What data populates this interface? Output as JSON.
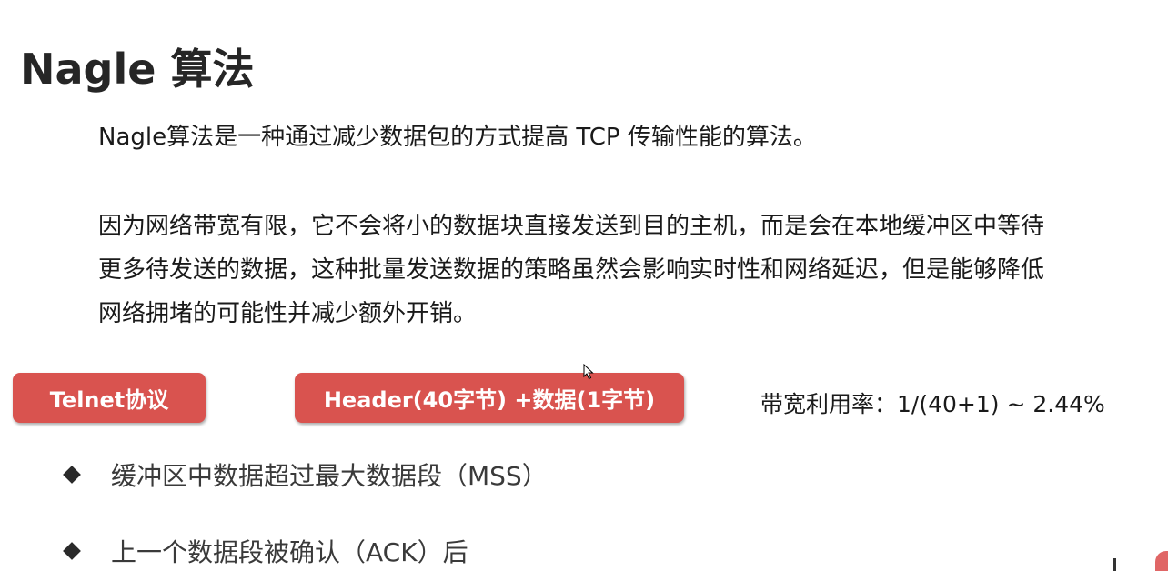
{
  "title": "Nagle 算法",
  "intro": "Nagle算法是一种通过减少数据包的方式提高 TCP 传输性能的算法。",
  "explanation_lines": [
    "因为网络带宽有限，它不会将小的数据块直接发送到目的主机，而是会在本地缓冲区中等待",
    "更多待发送的数据，这种批量发送数据的策略虽然会影响实时性和网络延迟，但是能够降低",
    "网络拥堵的可能性并减少额外开销。"
  ],
  "telnet_label": "Telnet协议",
  "header_label": "Header(40字节) +数据(1字节)",
  "utilization": "带宽利用率：1/(40+1) ~ 2.44%",
  "bullets": [
    "缓冲区中数据超过最大数据段（MSS）",
    "上一个数据段被确认（ACK）后"
  ],
  "colors": {
    "pill": "#d9534f",
    "title": "#262626"
  },
  "icons": {
    "cursor": "mouse-pointer-icon",
    "bullet": "diamond-bullet-icon"
  }
}
